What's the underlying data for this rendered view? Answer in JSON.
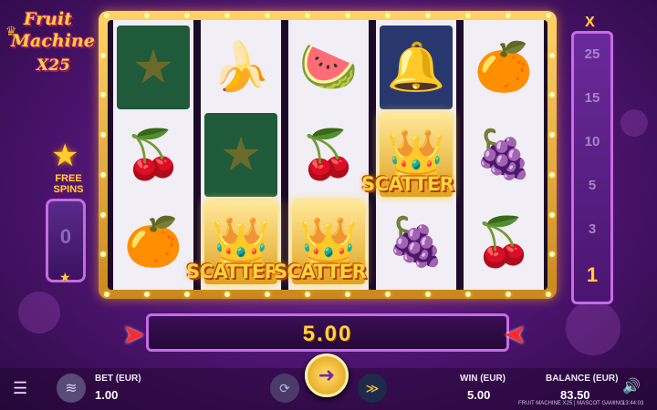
{
  "logo": {
    "line1": "Fruit",
    "line2": "Machine",
    "line3": "X25"
  },
  "free_spins": {
    "label_line1": "FREE",
    "label_line2": "SPINS",
    "count": "0"
  },
  "reels": [
    [
      "star-icon",
      "cherry-icon",
      "orange-icon"
    ],
    [
      "banana-icon",
      "star-icon",
      "crown-icon"
    ],
    [
      "watermelon-icon",
      "cherry-icon",
      "crown-icon"
    ],
    [
      "bell-icon",
      "crown-icon",
      "plum-icon"
    ],
    [
      "orange-icon",
      "plum-icon",
      "cherry-icon"
    ]
  ],
  "scatter": {
    "label1": "SCATTER",
    "label2": "SCATTER",
    "label3": "SCATTER"
  },
  "multiplier": {
    "symbol": "X",
    "steps": [
      "25",
      "15",
      "10",
      "5",
      "3",
      "1"
    ],
    "active": "1"
  },
  "win_banner": {
    "value": "5.00"
  },
  "bottom_bar": {
    "bet_label": "BET (EUR)",
    "bet_value": "1.00",
    "win_label": "WIN (EUR)",
    "win_value": "5.00",
    "balance_label": "BALANCE (EUR)",
    "balance_value": "83.50",
    "game_info": "FRUIT MACHINE X25 | MASCOT GAMING",
    "clock": "13:44:03"
  },
  "colors": {
    "gold": "#ffd23a",
    "purple": "#4d1470",
    "frame": "#e0a322"
  }
}
